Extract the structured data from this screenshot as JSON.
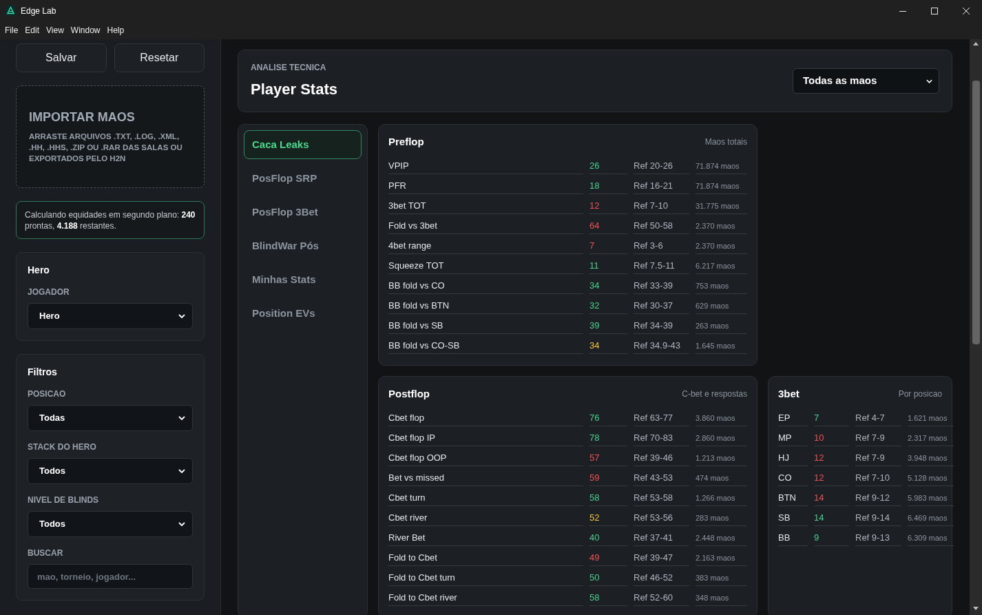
{
  "window": {
    "title": "Edge Lab"
  },
  "menu": [
    "File",
    "Edit",
    "View",
    "Window",
    "Help"
  ],
  "sidebar": {
    "buttons": [
      "Salvar",
      "Resetar"
    ],
    "import": {
      "title": "IMPORTAR MAOS",
      "description": "ARRASTE ARQUIVOS .TXT, .LOG, .XML, .HH, .HHS, .ZIP OU .RAR DAS SALAS OU EXPORTADOS PELO H2N"
    },
    "status": "Calculando equidades em segundo plano: **240** prontas, **4.188** restantes.",
    "cards": [
      {
        "title": "Hero",
        "fields": [
          {
            "label": "JOGADOR",
            "kind": "select",
            "value": "Hero"
          }
        ]
      },
      {
        "title": "Filtros",
        "fields": [
          {
            "label": "POSICAO",
            "kind": "select",
            "value": "Todas"
          },
          {
            "label": "STACK DO HERO",
            "kind": "select",
            "value": "Todos"
          },
          {
            "label": "NIVEL DE BLINDS",
            "kind": "select",
            "value": "Todos"
          },
          {
            "label": "BUSCAR",
            "kind": "input",
            "placeholder": "mao, torneio, jogador..."
          }
        ]
      }
    ]
  },
  "header": {
    "eyebrow": "ANALISE TECNICA",
    "title": "Player Stats",
    "select": "Todas as maos"
  },
  "nav": [
    {
      "label": "Caca Leaks",
      "selected": true
    },
    {
      "label": "PosFlop SRP",
      "selected": false
    },
    {
      "label": "PosFlop 3Bet",
      "selected": false
    },
    {
      "label": "BlindWar Pós",
      "selected": false
    },
    {
      "label": "Minhas Stats",
      "selected": false
    },
    {
      "label": "Position EVs",
      "selected": false
    }
  ],
  "panels": [
    {
      "title": "Preflop",
      "subtitle": "Maos totais",
      "rows": [
        {
          "stat": "VPIP",
          "value": "26",
          "color": "#4ad28c",
          "ref": "Ref 20-26",
          "hands": "71.874 maos"
        },
        {
          "stat": "PFR",
          "value": "18",
          "color": "#4ad28c",
          "ref": "Ref 16-21",
          "hands": "71.874 maos"
        },
        {
          "stat": "3bet TOT",
          "value": "12",
          "color": "#f05252",
          "ref": "Ref 7-10",
          "hands": "31.775 maos"
        },
        {
          "stat": "Fold vs 3bet",
          "value": "64",
          "color": "#f05252",
          "ref": "Ref 50-58",
          "hands": "2.370 maos"
        },
        {
          "stat": "4bet range",
          "value": "7",
          "color": "#f05252",
          "ref": "Ref 3-6",
          "hands": "2.370 maos"
        },
        {
          "stat": "Squeeze TOT",
          "value": "11",
          "color": "#4ad28c",
          "ref": "Ref 7.5-11",
          "hands": "6.217 maos"
        },
        {
          "stat": "BB fold vs CO",
          "value": "34",
          "color": "#4ad28c",
          "ref": "Ref 33-39",
          "hands": "753 maos"
        },
        {
          "stat": "BB fold vs BTN",
          "value": "32",
          "color": "#4ad28c",
          "ref": "Ref 30-37",
          "hands": "629 maos"
        },
        {
          "stat": "BB fold vs SB",
          "value": "39",
          "color": "#4ad28c",
          "ref": "Ref 34-39",
          "hands": "263 maos"
        },
        {
          "stat": "BB fold vs CO-SB",
          "value": "34",
          "color": "#f5c442",
          "ref": "Ref 34.9-43",
          "hands": "1.645 maos"
        }
      ]
    },
    {
      "title": "Postflop",
      "subtitle": "C-bet e respostas",
      "rows": [
        {
          "stat": "Cbet flop",
          "value": "76",
          "color": "#4ad28c",
          "ref": "Ref 63-77",
          "hands": "3.860 maos"
        },
        {
          "stat": "Cbet flop IP",
          "value": "78",
          "color": "#4ad28c",
          "ref": "Ref 70-83",
          "hands": "2.860 maos"
        },
        {
          "stat": "Cbet flop OOP",
          "value": "57",
          "color": "#f05252",
          "ref": "Ref 39-46",
          "hands": "1.213 maos"
        },
        {
          "stat": "Bet vs missed",
          "value": "59",
          "color": "#f05252",
          "ref": "Ref 43-53",
          "hands": "474 maos"
        },
        {
          "stat": "Cbet turn",
          "value": "58",
          "color": "#4ad28c",
          "ref": "Ref 53-58",
          "hands": "1.266 maos"
        },
        {
          "stat": "Cbet river",
          "value": "52",
          "color": "#f5c442",
          "ref": "Ref 53-56",
          "hands": "283 maos"
        },
        {
          "stat": "River Bet",
          "value": "40",
          "color": "#4ad28c",
          "ref": "Ref 37-41",
          "hands": "2.448 maos"
        },
        {
          "stat": "Fold to Cbet",
          "value": "49",
          "color": "#f05252",
          "ref": "Ref 39-47",
          "hands": "2.163 maos"
        },
        {
          "stat": "Fold to Cbet turn",
          "value": "50",
          "color": "#4ad28c",
          "ref": "Ref 46-52",
          "hands": "383 maos"
        },
        {
          "stat": "Fold to Cbet river",
          "value": "58",
          "color": "#4ad28c",
          "ref": "Ref 52-60",
          "hands": "348 maos"
        }
      ]
    },
    {
      "title": "3bet",
      "subtitle": "Por posicao",
      "rows": [
        {
          "stat": "EP",
          "value": "7",
          "color": "#4ad28c",
          "ref": "Ref 4-7",
          "hands": "1.621 maos"
        },
        {
          "stat": "MP",
          "value": "10",
          "color": "#f05252",
          "ref": "Ref 7-9",
          "hands": "2.317 maos"
        },
        {
          "stat": "HJ",
          "value": "12",
          "color": "#f05252",
          "ref": "Ref 7-9",
          "hands": "3.948 maos"
        },
        {
          "stat": "CO",
          "value": "12",
          "color": "#f05252",
          "ref": "Ref 7-10",
          "hands": "5.128 maos"
        },
        {
          "stat": "BTN",
          "value": "14",
          "color": "#f05252",
          "ref": "Ref 9-12",
          "hands": "5.983 maos"
        },
        {
          "stat": "SB",
          "value": "14",
          "color": "#4ad28c",
          "ref": "Ref 9-14",
          "hands": "6.469 maos"
        },
        {
          "stat": "BB",
          "value": "9",
          "color": "#4ad28c",
          "ref": "Ref 9-13",
          "hands": "6.309 maos"
        }
      ]
    }
  ]
}
